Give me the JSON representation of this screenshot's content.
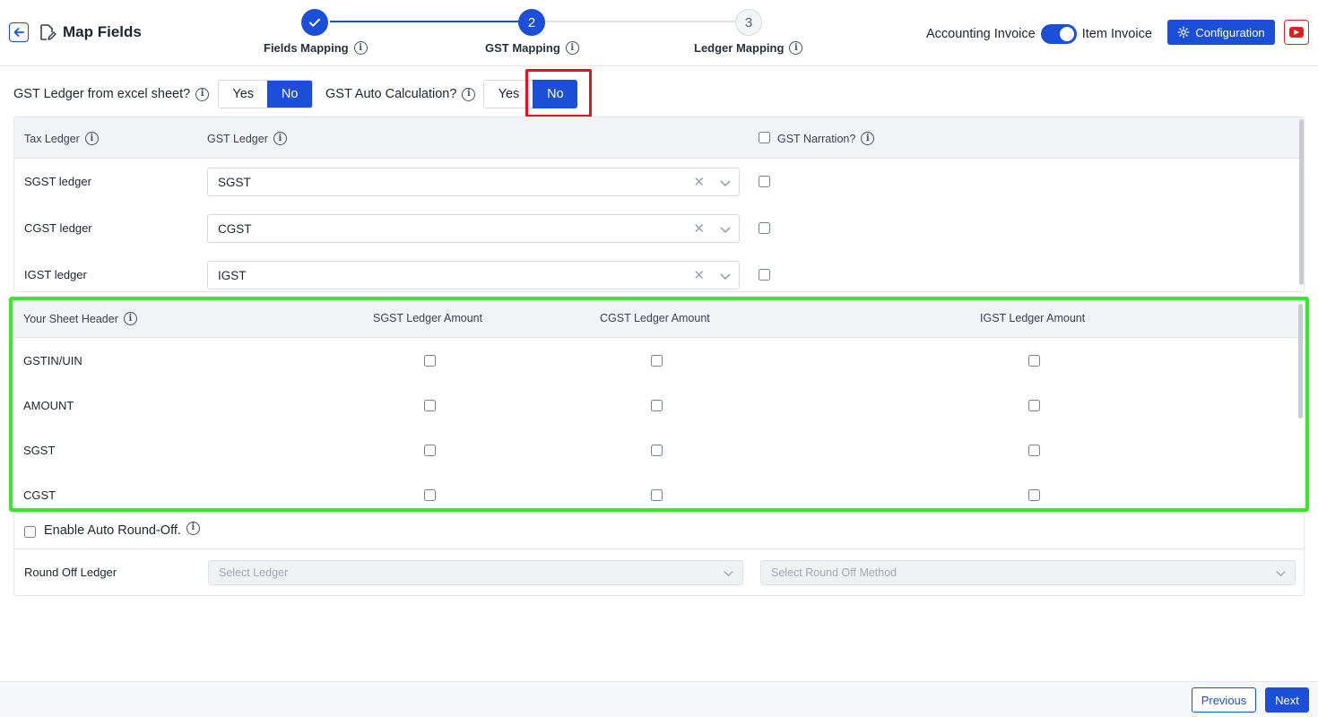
{
  "header": {
    "title": "Map Fields",
    "steps": [
      {
        "number": "1",
        "label": "Fields Mapping",
        "state": "done"
      },
      {
        "number": "2",
        "label": "GST Mapping",
        "state": "active"
      },
      {
        "number": "3",
        "label": "Ledger Mapping",
        "state": "pending"
      }
    ],
    "toggle_left": "Accounting Invoice",
    "toggle_right": "Item Invoice",
    "configuration_label": "Configuration"
  },
  "options": {
    "gst_ledger_from_excel": {
      "label": "GST Ledger from excel sheet?",
      "yes": "Yes",
      "no": "No",
      "selected": "No"
    },
    "gst_auto_calculation": {
      "label": "GST Auto Calculation?",
      "yes": "Yes",
      "no": "No",
      "selected": "No"
    }
  },
  "tax_table": {
    "headers": {
      "tax_ledger": "Tax Ledger",
      "gst_ledger": "GST Ledger",
      "gst_narration": "GST Narration?"
    },
    "rows": [
      {
        "label": "SGST ledger",
        "value": "SGST"
      },
      {
        "label": "CGST ledger",
        "value": "CGST"
      },
      {
        "label": "IGST ledger",
        "value": "IGST"
      }
    ]
  },
  "sheet_table": {
    "headers": {
      "sheet_header": "Your Sheet Header",
      "sgst": "SGST Ledger Amount",
      "cgst": "CGST Ledger Amount",
      "igst": "IGST Ledger Amount"
    },
    "rows": [
      {
        "label": "GSTIN/UIN"
      },
      {
        "label": "AMOUNT"
      },
      {
        "label": "SGST"
      },
      {
        "label": "CGST"
      }
    ]
  },
  "round_off": {
    "enable_label": "Enable Auto Round-Off.",
    "ledger_label": "Round Off Ledger",
    "ledger_placeholder": "Select Ledger",
    "method_placeholder": "Select Round Off Method"
  },
  "footer": {
    "previous": "Previous",
    "next": "Next"
  },
  "colors": {
    "primary": "#1b4fd8",
    "highlight_red": "#e8101a",
    "highlight_green": "#39e82a"
  }
}
